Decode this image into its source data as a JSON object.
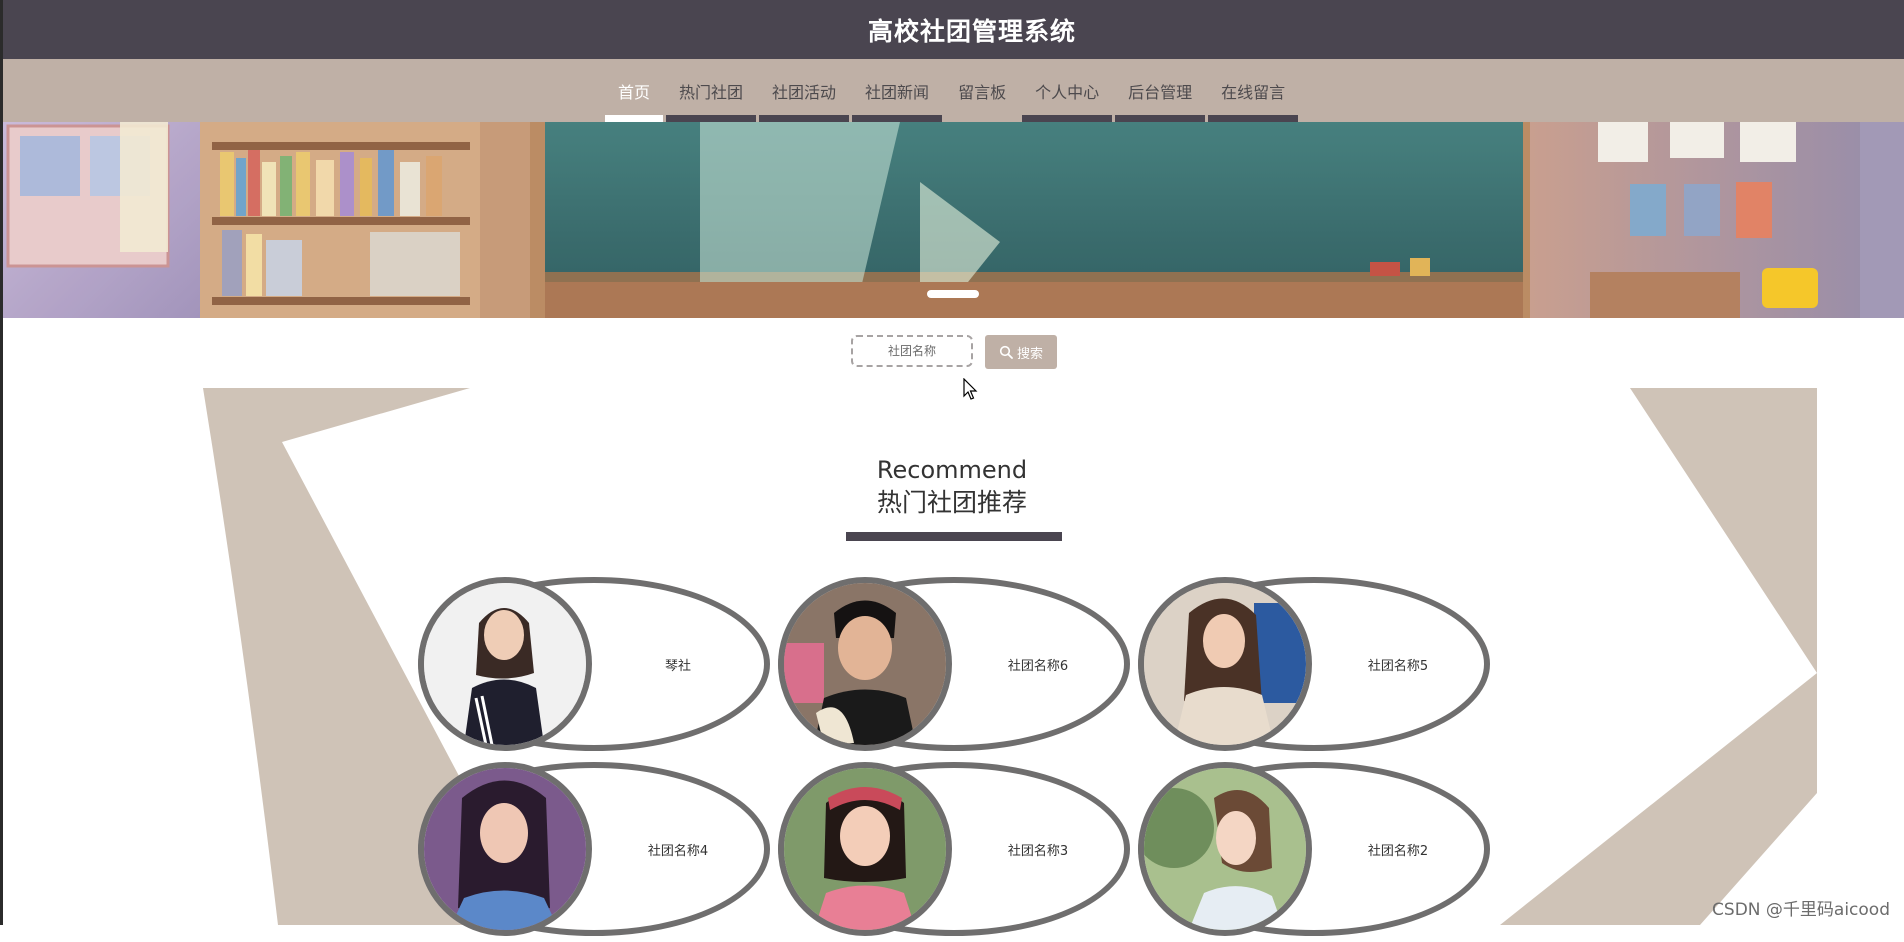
{
  "header": {
    "title": "高校社团管理系统"
  },
  "nav": {
    "items": [
      {
        "label": "首页",
        "active": true
      },
      {
        "label": "热门社团",
        "active": false
      },
      {
        "label": "社团活动",
        "active": false
      },
      {
        "label": "社团新闻",
        "active": false
      },
      {
        "label": "留言板",
        "active": false
      },
      {
        "label": "个人中心",
        "active": false
      },
      {
        "label": "后台管理",
        "active": false
      },
      {
        "label": "在线留言",
        "active": false
      }
    ]
  },
  "search": {
    "placeholder": "社团名称",
    "button_label": "搜索"
  },
  "section": {
    "title_en": "Recommend",
    "title_cn": "热门社团推荐"
  },
  "clubs": [
    {
      "name": "琴社"
    },
    {
      "name": "社团名称6"
    },
    {
      "name": "社团名称5"
    },
    {
      "name": "社团名称4"
    },
    {
      "name": "社团名称3"
    },
    {
      "name": "社团名称2"
    }
  ],
  "watermark": "CSDN @千里码aicood",
  "colors": {
    "header": "#4a4550",
    "nav": "#bfb0a6",
    "accent": "#4a4550",
    "shape": "#cfc3b7",
    "card_border": "#6f6e6e"
  }
}
